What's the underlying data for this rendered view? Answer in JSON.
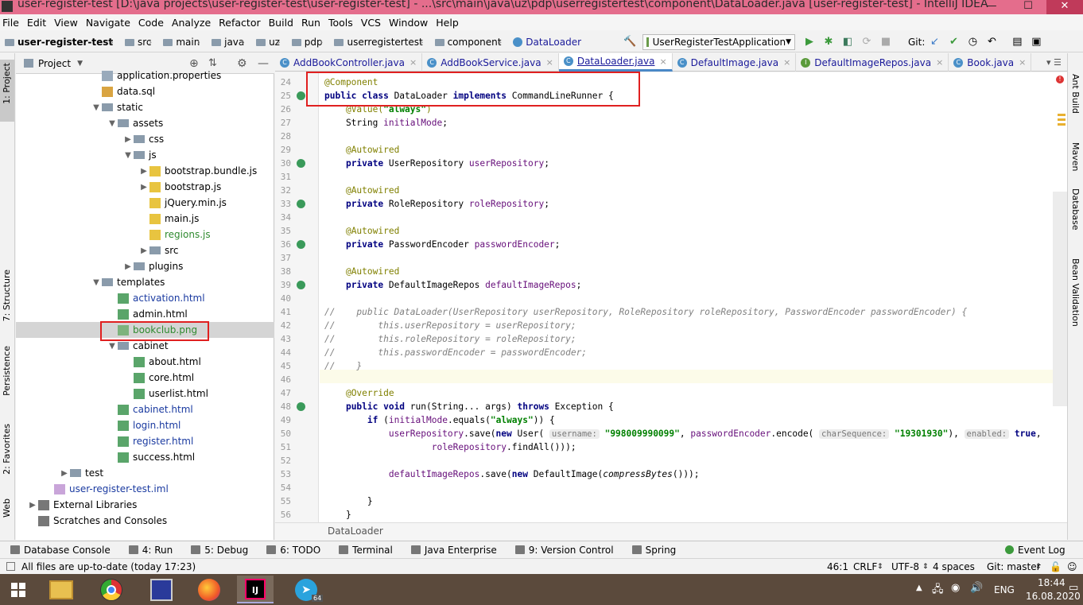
{
  "window": {
    "title": "user-register-test [D:\\java projects\\user-register-test\\user-register-test] - ...\\src\\main\\java\\uz\\pdp\\userregistertest\\component\\DataLoader.java [user-register-test] - IntelliJ IDEA",
    "min": "—",
    "max": "☐",
    "close": "✕"
  },
  "menu": [
    "File",
    "Edit",
    "View",
    "Navigate",
    "Code",
    "Analyze",
    "Refactor",
    "Build",
    "Run",
    "Tools",
    "VCS",
    "Window",
    "Help"
  ],
  "breadcrumbs": [
    "user-register-test",
    "src",
    "main",
    "java",
    "uz",
    "pdp",
    "userregistertest",
    "component",
    "DataLoader"
  ],
  "run_config": "UserRegisterTestApplication",
  "git_label": "Git:",
  "project_panel": {
    "title": "Project",
    "tree": [
      {
        "label": "application.properties",
        "depth": 4,
        "icon": "prop",
        "arrow": ""
      },
      {
        "label": "data.sql",
        "depth": 4,
        "icon": "sql",
        "arrow": ""
      },
      {
        "label": "static",
        "depth": 4,
        "icon": "folder",
        "arrow": "▼"
      },
      {
        "label": "assets",
        "depth": 5,
        "icon": "folder",
        "arrow": "▼"
      },
      {
        "label": "css",
        "depth": 6,
        "icon": "folder",
        "arrow": "▶"
      },
      {
        "label": "js",
        "depth": 6,
        "icon": "folder",
        "arrow": "▼"
      },
      {
        "label": "bootstrap.bundle.js",
        "depth": 7,
        "icon": "js",
        "arrow": "▶"
      },
      {
        "label": "bootstrap.js",
        "depth": 7,
        "icon": "js",
        "arrow": "▶"
      },
      {
        "label": "jQuery.min.js",
        "depth": 7,
        "icon": "js",
        "arrow": ""
      },
      {
        "label": "main.js",
        "depth": 7,
        "icon": "js",
        "arrow": ""
      },
      {
        "label": "regions.js",
        "depth": 7,
        "icon": "js",
        "arrow": "",
        "green": true
      },
      {
        "label": "src",
        "depth": 7,
        "icon": "folder",
        "arrow": "▶"
      },
      {
        "label": "plugins",
        "depth": 6,
        "icon": "folder",
        "arrow": "▶"
      },
      {
        "label": "templates",
        "depth": 4,
        "icon": "folder",
        "arrow": "▼"
      },
      {
        "label": "activation.html",
        "depth": 5,
        "icon": "html",
        "arrow": "",
        "blue": true
      },
      {
        "label": "admin.html",
        "depth": 5,
        "icon": "html",
        "arrow": ""
      },
      {
        "label": "bookclub.png",
        "depth": 5,
        "icon": "img",
        "arrow": "",
        "green": true,
        "selected": true
      },
      {
        "label": "cabinet",
        "depth": 5,
        "icon": "folder",
        "arrow": "▼"
      },
      {
        "label": "about.html",
        "depth": 6,
        "icon": "html",
        "arrow": ""
      },
      {
        "label": "core.html",
        "depth": 6,
        "icon": "html",
        "arrow": ""
      },
      {
        "label": "userlist.html",
        "depth": 6,
        "icon": "html",
        "arrow": ""
      },
      {
        "label": "cabinet.html",
        "depth": 5,
        "icon": "html",
        "arrow": "",
        "blue": true
      },
      {
        "label": "login.html",
        "depth": 5,
        "icon": "html",
        "arrow": "",
        "blue": true
      },
      {
        "label": "register.html",
        "depth": 5,
        "icon": "html",
        "arrow": "",
        "blue": true
      },
      {
        "label": "success.html",
        "depth": 5,
        "icon": "html",
        "arrow": ""
      },
      {
        "label": "test",
        "depth": 2,
        "icon": "folder",
        "arrow": "▶"
      },
      {
        "label": "user-register-test.iml",
        "depth": 1,
        "icon": "iml",
        "arrow": "",
        "blue": true
      },
      {
        "label": "External Libraries",
        "depth": 0,
        "icon": "lib",
        "arrow": "▶"
      },
      {
        "label": "Scratches and Consoles",
        "depth": 0,
        "icon": "lib",
        "arrow": ""
      }
    ]
  },
  "tabs": [
    {
      "label": "AddBookController.java",
      "icon": "C",
      "active": false
    },
    {
      "label": "AddBookService.java",
      "icon": "C",
      "active": false
    },
    {
      "label": "DataLoader.java",
      "icon": "C",
      "active": true
    },
    {
      "label": "DefaultImage.java",
      "icon": "C",
      "active": false
    },
    {
      "label": "DefaultImageRepos.java",
      "icon": "I",
      "active": false
    },
    {
      "label": "Book.java",
      "icon": "C",
      "active": false
    }
  ],
  "editor": {
    "breadcrumb": "DataLoader",
    "lines": [
      {
        "n": "24",
        "html": "<span class=\"an\">@Component</span>"
      },
      {
        "n": "25",
        "html": "<span class=\"kw\">public class</span> DataLoader <span class=\"kw\">implements</span> CommandLineRunner {",
        "gi": true
      },
      {
        "n": "26",
        "html": "    <span class=\"an\">@Value(</span><span class=\"st\">\"always\"</span><span class=\"an\">)</span>"
      },
      {
        "n": "27",
        "html": "    String <span class=\"fd\">initialMode</span>;"
      },
      {
        "n": "28",
        "html": ""
      },
      {
        "n": "29",
        "html": "    <span class=\"an\">@Autowired</span>"
      },
      {
        "n": "30",
        "html": "    <span class=\"kw\">private</span> UserRepository <span class=\"fd\">userRepository</span>;",
        "gi": true
      },
      {
        "n": "31",
        "html": ""
      },
      {
        "n": "32",
        "html": "    <span class=\"an\">@Autowired</span>"
      },
      {
        "n": "33",
        "html": "    <span class=\"kw\">private</span> RoleRepository <span class=\"fd\">roleRepository</span>;",
        "gi": true
      },
      {
        "n": "34",
        "html": ""
      },
      {
        "n": "35",
        "html": "    <span class=\"an\">@Autowired</span>"
      },
      {
        "n": "36",
        "html": "    <span class=\"kw\">private</span> PasswordEncoder <span class=\"fd\">passwordEncoder</span>;",
        "gi": true
      },
      {
        "n": "37",
        "html": ""
      },
      {
        "n": "38",
        "html": "    <span class=\"an\">@Autowired</span>"
      },
      {
        "n": "39",
        "html": "    <span class=\"kw\">private</span> DefaultImageRepos <span class=\"fd\">defaultImageRepos</span>;",
        "gi": true
      },
      {
        "n": "40",
        "html": ""
      },
      {
        "n": "41",
        "html": "<span class=\"cm\">//    public DataLoader(UserRepository userRepository, RoleRepository roleRepository, PasswordEncoder passwordEncoder) {</span>"
      },
      {
        "n": "42",
        "html": "<span class=\"cm\">//        this.userRepository = userRepository;</span>"
      },
      {
        "n": "43",
        "html": "<span class=\"cm\">//        this.roleRepository = roleRepository;</span>"
      },
      {
        "n": "44",
        "html": "<span class=\"cm\">//        this.passwordEncoder = passwordEncoder;</span>"
      },
      {
        "n": "45",
        "html": "<span class=\"cm\">//    }</span>"
      },
      {
        "n": "46",
        "html": ""
      },
      {
        "n": "47",
        "html": "    <span class=\"an\">@Override</span>"
      },
      {
        "n": "48",
        "html": "    <span class=\"kw\">public void</span> run(String... args) <span class=\"kw\">throws</span> Exception {",
        "gi": true
      },
      {
        "n": "49",
        "html": "        <span class=\"kw\">if</span> (<span class=\"fd\">initialMode</span>.equals(<span class=\"st\">\"always\"</span>)) {"
      },
      {
        "n": "50",
        "html": "            <span class=\"fd\">userRepository</span>.save(<span class=\"kw\">new</span> User( <span class=\"hint\">username:</span> <span class=\"st\">\"998009990099\"</span>, <span class=\"fd\">passwordEncoder</span>.encode( <span class=\"hint\">charSequence:</span> <span class=\"st\">\"19301930\"</span>), <span class=\"hint\">enabled:</span> <span class=\"kw\">true</span>,"
      },
      {
        "n": "51",
        "html": "                    <span class=\"fd\">roleRepository</span>.findAll()));"
      },
      {
        "n": "52",
        "html": ""
      },
      {
        "n": "53",
        "html": "            <span class=\"fd\">defaultImageRepos</span>.save(<span class=\"kw\">new</span> DefaultImage(<i>compressBytes</i>()));"
      },
      {
        "n": "54",
        "html": ""
      },
      {
        "n": "55",
        "html": "        }"
      },
      {
        "n": "56",
        "html": "    }"
      }
    ]
  },
  "left_strip": [
    "1: Project",
    "7: Structure",
    "Persistence",
    "2: Favorites",
    "Web"
  ],
  "right_strip": [
    "Ant Build",
    "Maven",
    "Database",
    "Bean Validation"
  ],
  "tool_windows": [
    {
      "label": "Database Console"
    },
    {
      "label": "4: Run"
    },
    {
      "label": "5: Debug"
    },
    {
      "label": "6: TODO"
    },
    {
      "label": "Terminal"
    },
    {
      "label": "Java Enterprise"
    },
    {
      "label": "9: Version Control"
    },
    {
      "label": "Spring"
    }
  ],
  "event_log": "Event Log",
  "status": {
    "message": "All files are up-to-date (today 17:23)",
    "position": "46:1",
    "line_sep": "CRLF",
    "encoding": "UTF-8",
    "indent": "4 spaces",
    "git": "Git: master"
  },
  "taskbar": {
    "lang": "ENG",
    "time": "18:44",
    "date": "16.08.2020",
    "badge": "64"
  }
}
